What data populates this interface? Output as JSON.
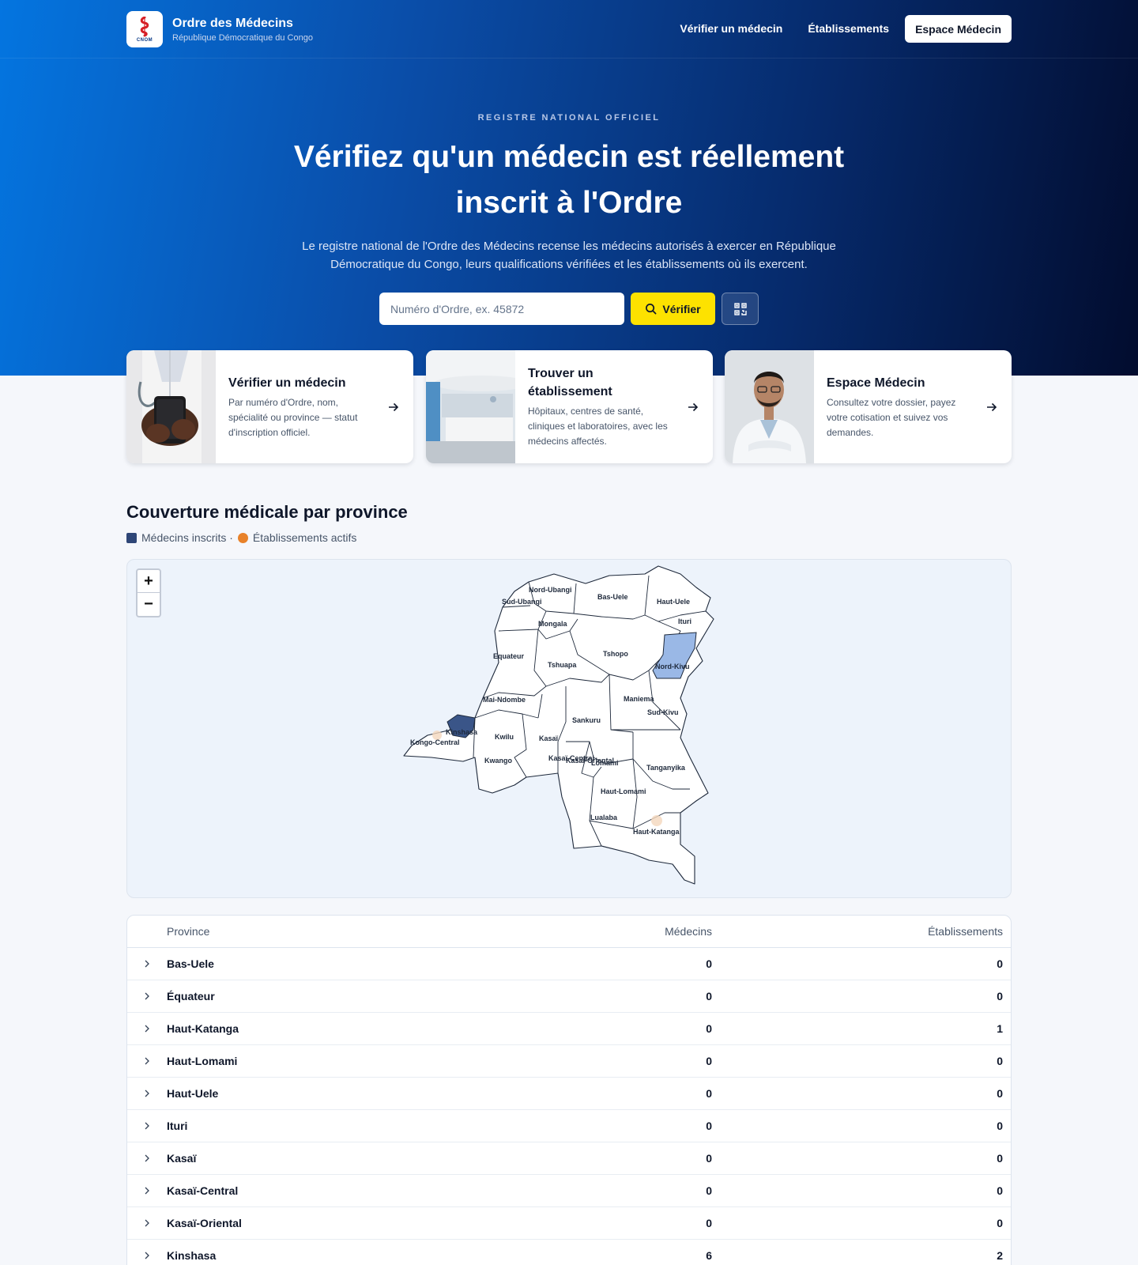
{
  "header": {
    "logo_text": "CNOM",
    "title": "Ordre des Médecins",
    "subtitle": "République Démocratique du Congo",
    "nav": [
      {
        "label": "Vérifier un médecin"
      },
      {
        "label": "Établissements"
      }
    ],
    "cta_label": "Espace Médecin"
  },
  "hero": {
    "eyebrow": "REGISTRE NATIONAL OFFICIEL",
    "title": "Vérifiez qu'un médecin est réellement inscrit à l'Ordre",
    "description": "Le registre national de l'Ordre des Médecins recense les médecins autorisés à exercer en République Démocratique du Congo, leurs qualifications vérifiées et les établissements où ils exercent.",
    "search_placeholder": "Numéro d'Ordre, ex. 45872",
    "verify_label": "Vérifier"
  },
  "cards": [
    {
      "title": "Vérifier un médecin",
      "description": "Par numéro d'Ordre, nom, spécialité ou province — statut d'inscription officiel."
    },
    {
      "title": "Trouver un établissement",
      "description": "Hôpitaux, centres de santé, cliniques et laboratoires, avec les médecins affectés."
    },
    {
      "title": "Espace Médecin",
      "description": "Consultez votre dossier, payez votre cotisation et suivez vos demandes."
    }
  ],
  "coverage": {
    "title": "Couverture médicale par province",
    "legend_doctors": "Médecins inscrits ·",
    "legend_facilities": "Établissements actifs",
    "colors": {
      "doctors": "#2e4677",
      "facilities": "#e8822a"
    }
  },
  "map": {
    "zoom_in": "+",
    "zoom_out": "−",
    "labels": [
      "Nord-Ubangi",
      "Sud-Ubangi",
      "Bas-Uele",
      "Haut-Uele",
      "Ituri",
      "Mongala",
      "Equateur",
      "Tshuapa",
      "Tshopo",
      "Nord-Kivu",
      "Mai-Ndombe",
      "Maniema",
      "Sud-Kivu",
      "Sankuru",
      "Kinshasa",
      "Kwilu",
      "Kasaï",
      "Kongo-Central",
      "Kwango",
      "Kasaï-Central",
      "Kasaï-Oriental",
      "Lomami",
      "Tanganyika",
      "Haut-Lomami",
      "Lualaba",
      "Haut-Katanga"
    ]
  },
  "table": {
    "headers": {
      "province": "Province",
      "doctors": "Médecins",
      "facilities": "Établissements"
    },
    "rows": [
      {
        "province": "Bas-Uele",
        "doctors": "0",
        "facilities": "0"
      },
      {
        "province": "Équateur",
        "doctors": "0",
        "facilities": "0"
      },
      {
        "province": "Haut-Katanga",
        "doctors": "0",
        "facilities": "1"
      },
      {
        "province": "Haut-Lomami",
        "doctors": "0",
        "facilities": "0"
      },
      {
        "province": "Haut-Uele",
        "doctors": "0",
        "facilities": "0"
      },
      {
        "province": "Ituri",
        "doctors": "0",
        "facilities": "0"
      },
      {
        "province": "Kasaï",
        "doctors": "0",
        "facilities": "0"
      },
      {
        "province": "Kasaï-Central",
        "doctors": "0",
        "facilities": "0"
      },
      {
        "province": "Kasaï-Oriental",
        "doctors": "0",
        "facilities": "0"
      },
      {
        "province": "Kinshasa",
        "doctors": "6",
        "facilities": "2"
      }
    ]
  }
}
